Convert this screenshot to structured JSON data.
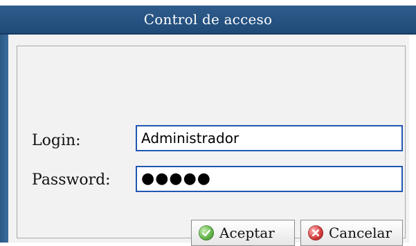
{
  "window": {
    "title": "Control de acceso"
  },
  "form": {
    "login_label": "Login:",
    "login_value": "Administrador",
    "password_label": "Password:",
    "password_masked": "●●●●●"
  },
  "buttons": {
    "accept_label": "Aceptar",
    "cancel_label": "Cancelar"
  },
  "icons": {
    "accept_icon": "check-circle-icon",
    "cancel_icon": "x-circle-icon"
  },
  "colors": {
    "titlebar_blue": "#1f4a78",
    "input_border_blue": "#1f56b2",
    "panel_gray": "#f2f2f2"
  }
}
